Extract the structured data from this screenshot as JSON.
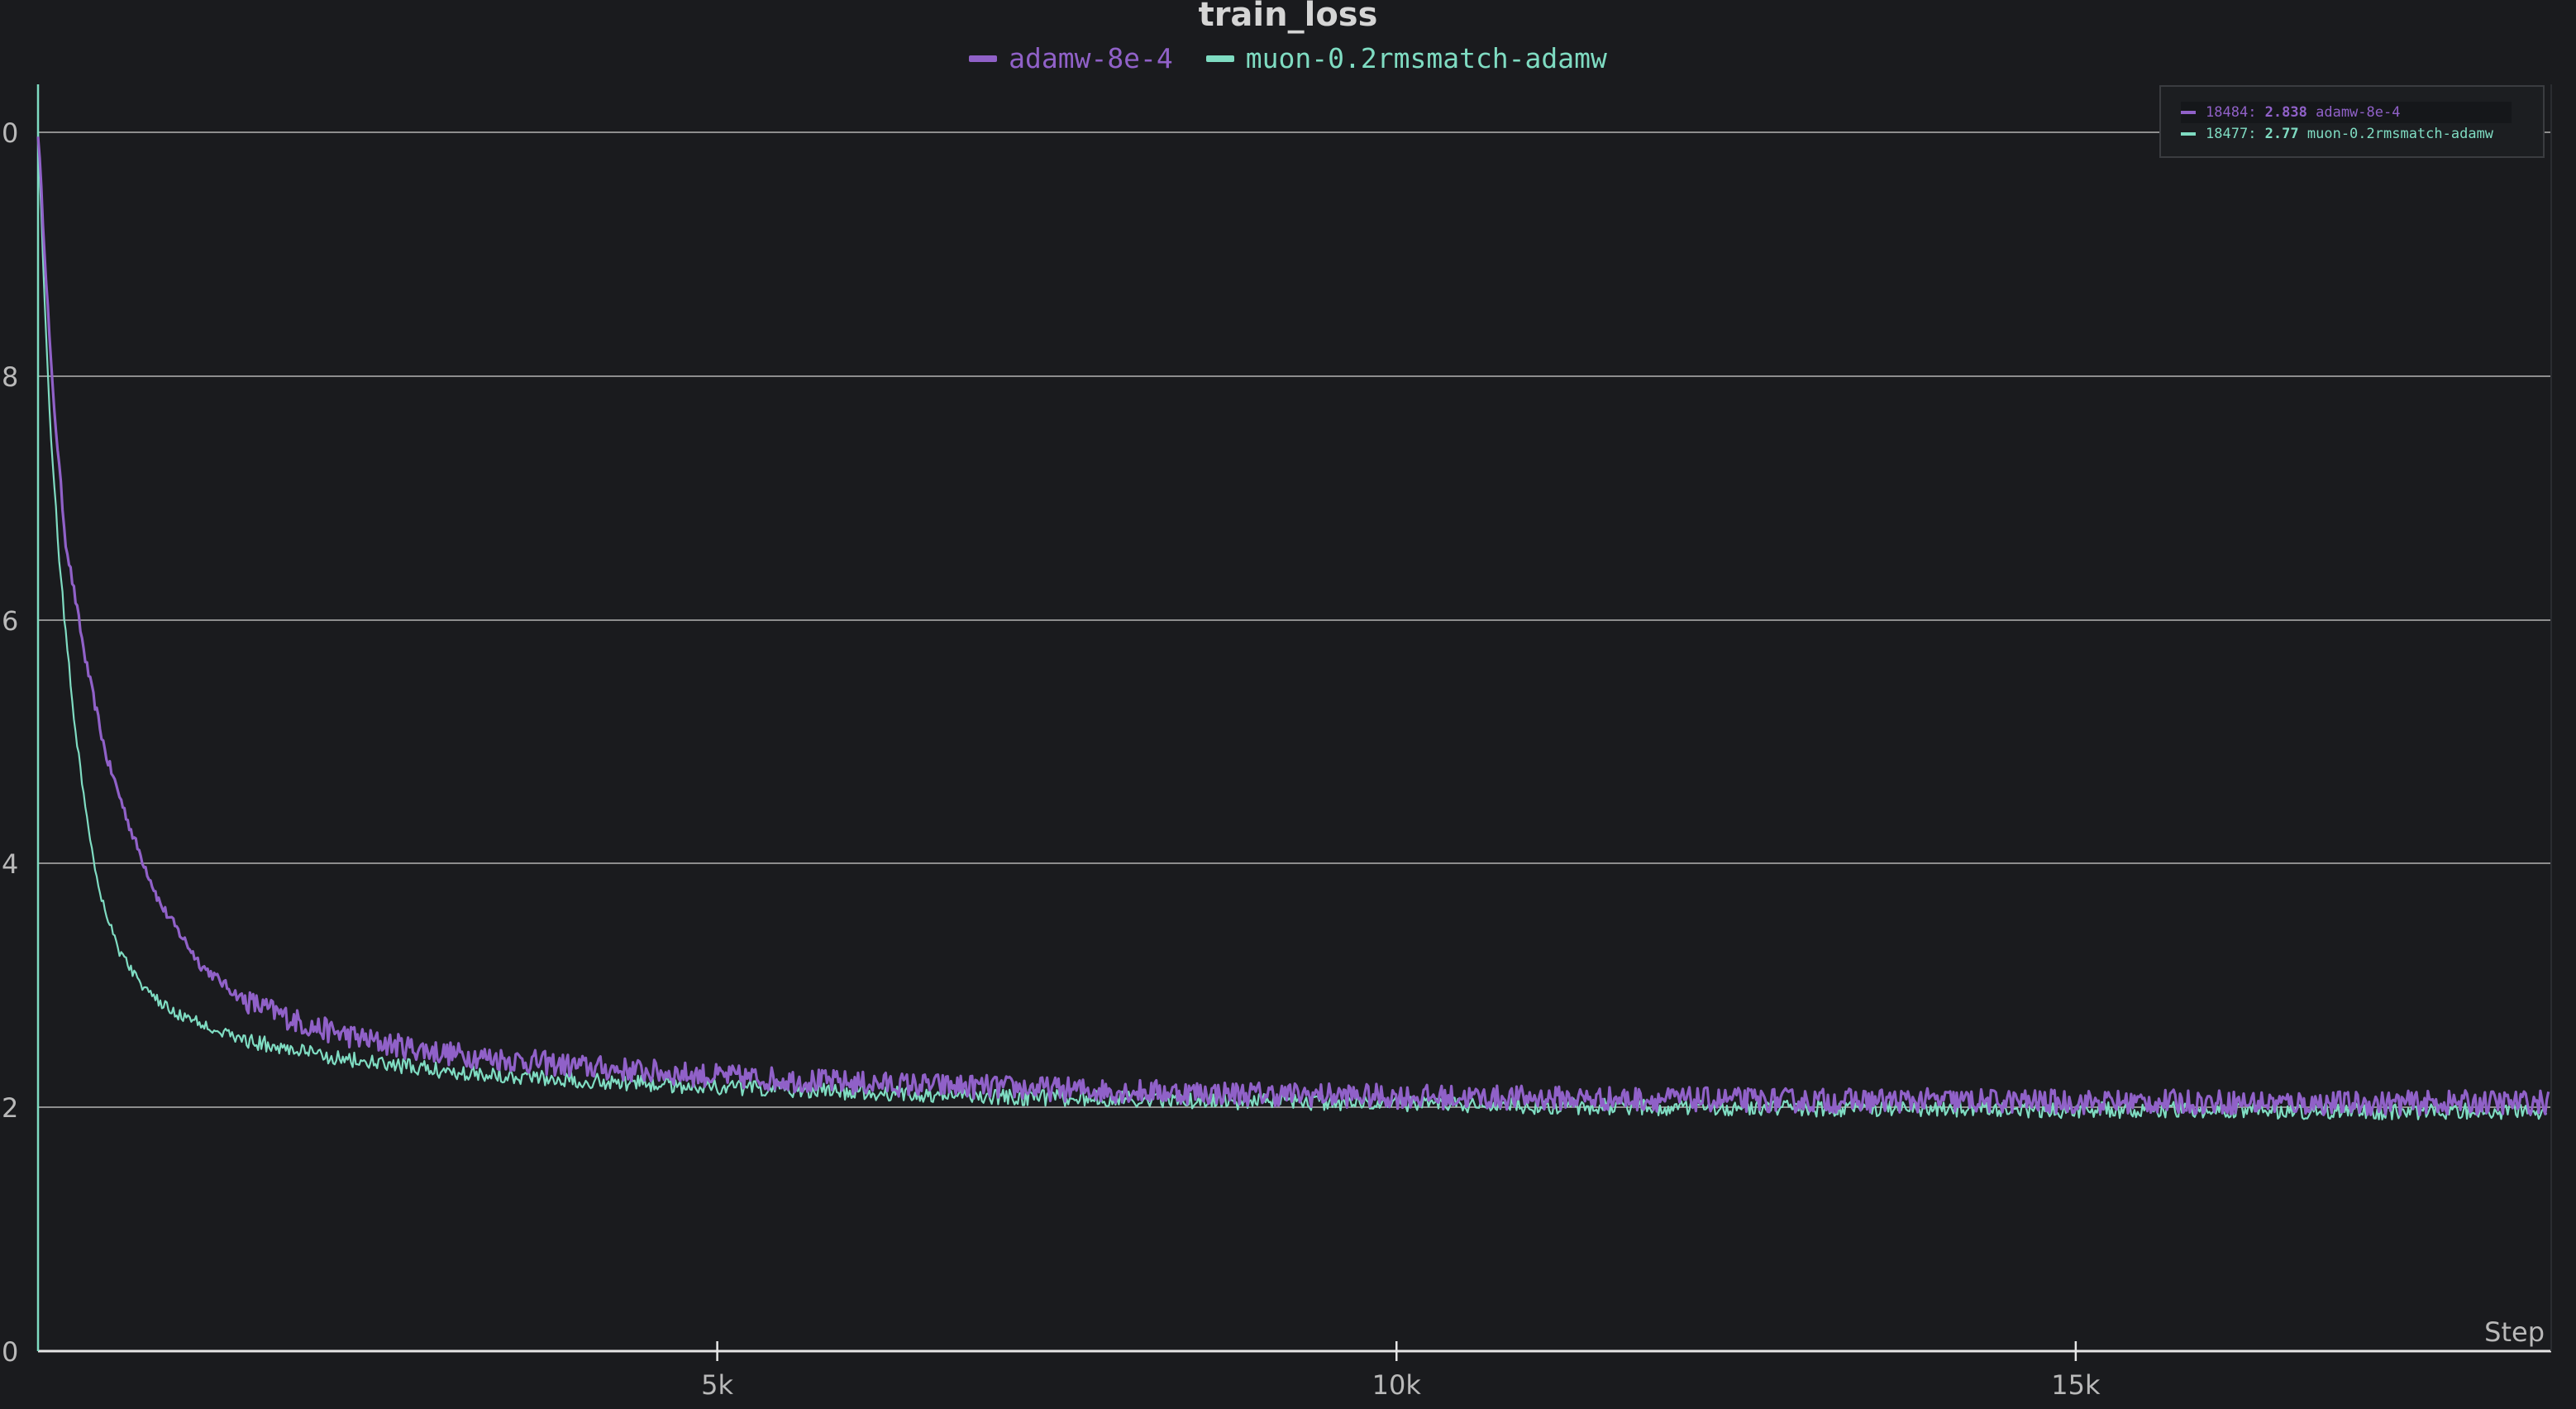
{
  "colors": {
    "background": "#1a1b1e",
    "grid": "#cfcfcf",
    "axis_text": "#b9b9b9",
    "title": "#d5d5d5"
  },
  "chart_data": {
    "type": "line",
    "title": "train_loss",
    "xlabel": "Step",
    "ylabel": "",
    "xlim": [
      0,
      18500
    ],
    "ylim": [
      2.0,
      10.0
    ],
    "x_ticks": [
      5000,
      10000,
      15000
    ],
    "x_tick_labels": [
      "5k",
      "10k",
      "15k"
    ],
    "y_ticks": [
      2.0,
      4.0,
      6.0,
      8.0,
      10.0
    ],
    "y_tick_labels": [
      "0",
      "2",
      "4",
      "6",
      "8",
      "0"
    ],
    "grid": true,
    "legend_position": "top-center",
    "series": [
      {
        "name": "adamw-8e-4",
        "color": "#9061c8",
        "points": [
          [
            0,
            10.0
          ],
          [
            100,
            8.2
          ],
          [
            200,
            7.0
          ],
          [
            350,
            6.1
          ],
          [
            500,
            5.4
          ],
          [
            700,
            4.8
          ],
          [
            900,
            4.3
          ],
          [
            1200,
            3.85
          ],
          [
            1500,
            3.6
          ],
          [
            2000,
            3.4
          ],
          [
            2500,
            3.28
          ],
          [
            3000,
            3.2
          ],
          [
            4000,
            3.1
          ],
          [
            5000,
            3.03
          ],
          [
            6000,
            2.98
          ],
          [
            7000,
            2.95
          ],
          [
            8000,
            2.92
          ],
          [
            9000,
            2.9
          ],
          [
            10000,
            2.88
          ],
          [
            11000,
            2.87
          ],
          [
            12000,
            2.86
          ],
          [
            13000,
            2.85
          ],
          [
            14000,
            2.85
          ],
          [
            15000,
            2.84
          ],
          [
            16000,
            2.84
          ],
          [
            17000,
            2.83
          ],
          [
            18484,
            2.838
          ]
        ]
      },
      {
        "name": "muon-0.2rmsmatch-adamw",
        "color": "#7fdcc2",
        "points": [
          [
            0,
            10.0
          ],
          [
            80,
            8.0
          ],
          [
            160,
            6.8
          ],
          [
            250,
            5.8
          ],
          [
            350,
            5.0
          ],
          [
            450,
            4.4
          ],
          [
            600,
            3.95
          ],
          [
            800,
            3.65
          ],
          [
            1000,
            3.5
          ],
          [
            1500,
            3.3
          ],
          [
            2000,
            3.2
          ],
          [
            2500,
            3.12
          ],
          [
            3000,
            3.07
          ],
          [
            4000,
            3.0
          ],
          [
            5000,
            2.95
          ],
          [
            6000,
            2.91
          ],
          [
            7000,
            2.88
          ],
          [
            8000,
            2.86
          ],
          [
            9000,
            2.84
          ],
          [
            10000,
            2.83
          ],
          [
            11000,
            2.81
          ],
          [
            12000,
            2.8
          ],
          [
            13000,
            2.79
          ],
          [
            14000,
            2.79
          ],
          [
            15000,
            2.78
          ],
          [
            16000,
            2.78
          ],
          [
            17000,
            2.77
          ],
          [
            18477,
            2.77
          ]
        ]
      }
    ],
    "tooltip": [
      {
        "step": "18484",
        "value": "2.838",
        "name": "adamw-8e-4",
        "color": "#9061c8"
      },
      {
        "step": "18477",
        "value": "2.77",
        "name": "muon-0.2rmsmatch-adamw",
        "color": "#7fdcc2"
      }
    ]
  }
}
